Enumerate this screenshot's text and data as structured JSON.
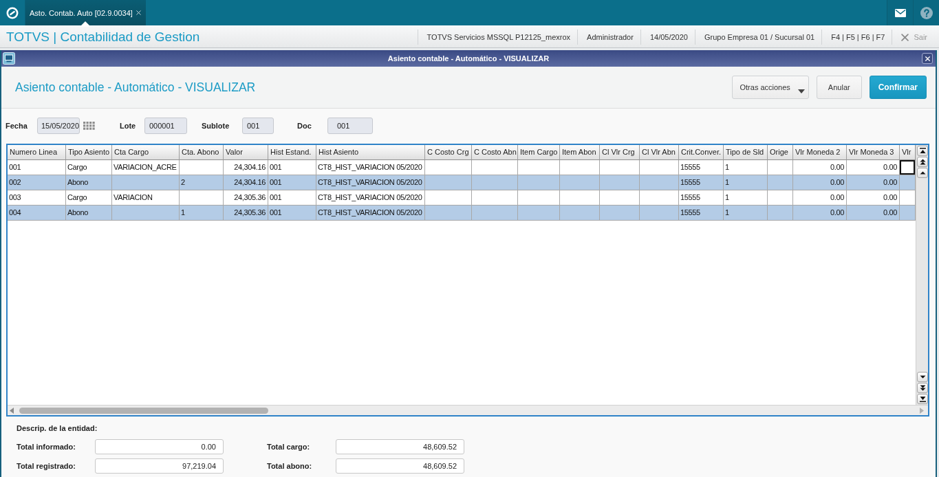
{
  "top_bar": {
    "tabs": [
      {
        "label": "Asto. Contab. Auto [02.9.0034]",
        "selected": true
      }
    ]
  },
  "header": {
    "title": "TOTVS | Contabilidad de Gestion",
    "environment": "TOTVS Servicios MSSQL P12125_mexrox",
    "user": "Administrador",
    "date": "14/05/2020",
    "company": "Grupo Empresa 01 / Sucursal 01",
    "shortcuts": "F4 | F5 | F6 | F7",
    "exit_label": "Sair"
  },
  "dialog": {
    "window_title": "Asiento contable - Automático - VISUALIZAR",
    "title": "Asiento contable - Automático - VISUALIZAR",
    "buttons": [
      {
        "label": "Otras acciones",
        "kind": "menu"
      },
      {
        "label": "Anular",
        "kind": "secondary"
      },
      {
        "label": "Confirmar",
        "kind": "primary"
      }
    ],
    "fields": [
      {
        "label": "Fecha",
        "value": "15/05/2020",
        "kind": "date"
      },
      {
        "label": "Lote",
        "value": "000001",
        "kind": "text"
      },
      {
        "label": "Sublote",
        "value": "001",
        "kind": "text"
      },
      {
        "label": "Doc",
        "value": "001",
        "kind": "text"
      }
    ],
    "grid": {
      "columns": [
        {
          "label": "Numero Linea",
          "kind": "text"
        },
        {
          "label": "Tipo Asiento",
          "kind": "text"
        },
        {
          "label": "Cta Cargo",
          "kind": "text"
        },
        {
          "label": "Cta. Abono",
          "kind": "text"
        },
        {
          "label": "Valor",
          "kind": "number"
        },
        {
          "label": "Hist Estand.",
          "kind": "text"
        },
        {
          "label": "Hist Asiento",
          "kind": "text"
        },
        {
          "label": "C Costo Crg",
          "kind": "text"
        },
        {
          "label": "C Costo Abn",
          "kind": "text"
        },
        {
          "label": "Item Cargo",
          "kind": "text"
        },
        {
          "label": "Item Abon",
          "kind": "text"
        },
        {
          "label": "Cl Vlr Crg",
          "kind": "text"
        },
        {
          "label": "Cl Vlr Abn",
          "kind": "text"
        },
        {
          "label": "Crit.Conver.",
          "kind": "text"
        },
        {
          "label": "Tipo de Sld",
          "kind": "text"
        },
        {
          "label": "Orige",
          "kind": "text"
        },
        {
          "label": "Vlr Moneda 2",
          "kind": "number"
        },
        {
          "label": "Vlr Moneda 3",
          "kind": "number"
        },
        {
          "label": "Vlr",
          "kind": "number"
        }
      ],
      "rows": [
        {
          "focused": true,
          "cells": [
            "001",
            "Cargo",
            "VARIACION_ACRE",
            null,
            "24,304.16",
            "001",
            "CT8_HIST_VARIACION 05/2020",
            null,
            null,
            null,
            null,
            null,
            null,
            "15555",
            "1",
            null,
            "0.00",
            "0.00",
            null
          ]
        },
        {
          "focused": false,
          "cells": [
            "002",
            "Abono",
            null,
            "2",
            "24,304.16",
            "001",
            "CT8_HIST_VARIACION 05/2020",
            null,
            null,
            null,
            null,
            null,
            null,
            "15555",
            "1",
            null,
            "0.00",
            "0.00",
            null
          ]
        },
        {
          "focused": false,
          "cells": [
            "003",
            "Cargo",
            "VARIACION",
            null,
            "24,305.36",
            "001",
            "CT8_HIST_VARIACION 05/2020",
            null,
            null,
            null,
            null,
            null,
            null,
            "15555",
            "1",
            null,
            "0.00",
            "0.00",
            null
          ]
        },
        {
          "focused": false,
          "cells": [
            "004",
            "Abono",
            null,
            "1",
            "24,305.36",
            "001",
            "CT8_HIST_VARIACION 05/2020",
            null,
            null,
            null,
            null,
            null,
            null,
            "15555",
            "1",
            null,
            "0.00",
            "0.00",
            null
          ]
        }
      ]
    },
    "summary": {
      "description_label": "Descrip. de la entidad:",
      "totals": [
        {
          "label": "Total informado:",
          "value": "0.00"
        },
        {
          "label": "Total cargo:",
          "value": "48,609.52"
        },
        {
          "label": "Total registrado:",
          "value": "97,219.04"
        },
        {
          "label": "Total abono:",
          "value": "48,609.52"
        }
      ]
    }
  }
}
